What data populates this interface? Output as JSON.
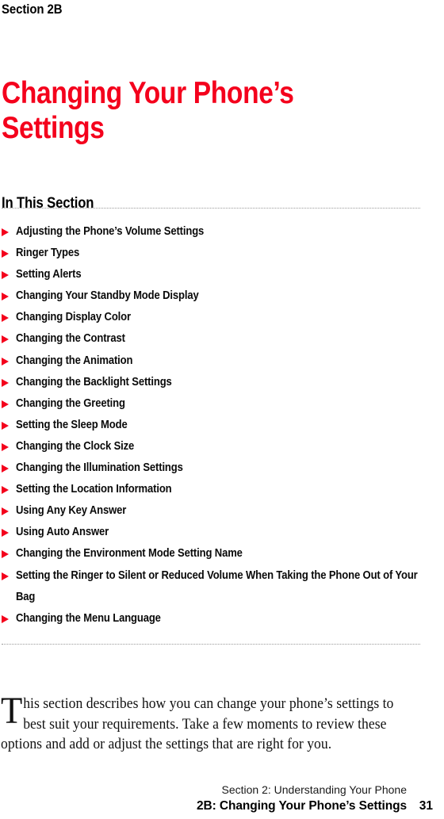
{
  "page": {
    "section_label": "Section 2B",
    "title": "Changing Your Phone’s Settings",
    "accent_color": "#f4001c"
  },
  "in_this_section": {
    "heading": "In This Section",
    "items": [
      "Adjusting the Phone’s Volume Settings",
      "Ringer Types",
      "Setting Alerts",
      "Changing Your Standby Mode Display",
      "Changing Display Color",
      "Changing the Contrast",
      "Changing the Animation",
      "Changing the Backlight Settings",
      "Changing the Greeting",
      "Setting the Sleep Mode",
      "Changing the Clock Size",
      "Changing the Illumination Settings",
      "Setting the Location Information",
      "Using Any Key Answer",
      "Using Auto Answer",
      "Changing the Environment Mode Setting Name",
      "Setting the Ringer to Silent or Reduced Volume When Taking the Phone Out of Your Bag",
      "Changing the Menu Language"
    ]
  },
  "intro": {
    "dropcap": "T",
    "text": "his section describes how you can change your phone’s settings to best suit your requirements. Take a few moments to review these options and add or adjust the settings that are right for you."
  },
  "footer": {
    "line1": "Section 2: Understanding Your Phone",
    "line2": "2B: Changing Your Phone’s Settings",
    "page_number": "31"
  }
}
